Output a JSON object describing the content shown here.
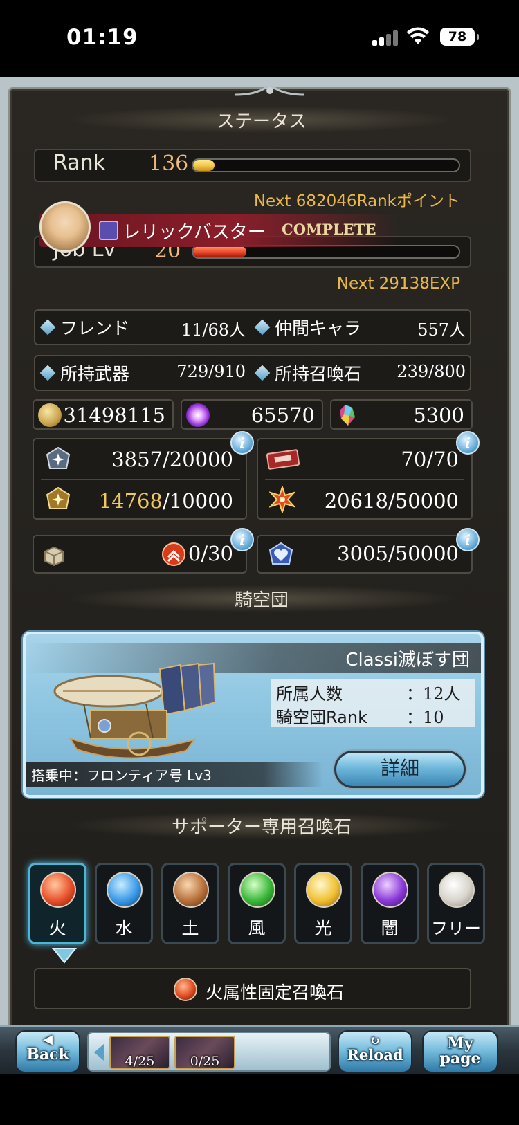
{
  "status_bar": {
    "time": "01:19",
    "battery": "78"
  },
  "status": {
    "title": "ステータス",
    "rank_label": "Rank",
    "rank_value": "136",
    "rank_progress": 0.08,
    "rank_next": "Next 682046Rankポイント",
    "job_name": "レリックバスター",
    "job_complete": "COMPLETE",
    "job_lv_label": "Job Lv",
    "job_lv_value": "20",
    "job_progress": 0.2,
    "job_next": "Next 29138EXP"
  },
  "counts": {
    "friends_label": "フレンド",
    "friends_value": "11/68人",
    "allies_label": "仲間キャラ",
    "allies_value": "557人",
    "weapons_label": "所持武器",
    "weapons_value": "729/910",
    "summons_label": "所持召喚石",
    "summons_value": "239/800"
  },
  "currencies": {
    "rupie": "31498115",
    "crystal_points": "65570",
    "crystals": "5300"
  },
  "items": {
    "item1": "3857/20000",
    "item2_current": "14768",
    "item2_max": "/10000",
    "item3": "70/70",
    "item4": "20618/50000",
    "item5": "0/30",
    "item6": "3005/50000"
  },
  "crew": {
    "section_title": "騎空団",
    "name": "Classi滅ぼす団",
    "members_label": "所属人数",
    "members_value": "：12人",
    "rank_label": "騎空団Rank",
    "rank_value": "：10",
    "boarding": "搭乗中：フロンティア号 Lv3",
    "detail_button": "詳細"
  },
  "supporter": {
    "section_title": "サポーター専用召喚石",
    "tabs": [
      "火",
      "水",
      "土",
      "風",
      "光",
      "闇",
      "フリー"
    ],
    "fixed_label": "火属性固定召喚石"
  },
  "nav": {
    "back": "Back",
    "quest1": "4/25",
    "quest2": "0/25",
    "reload": "Reload",
    "mypage_line1": "My",
    "mypage_line2": "page"
  },
  "colors": {
    "accent_gold": "#e9b84a",
    "rank_fill": "#f2c646",
    "job_fill": "#e8452a",
    "active_tab_glow": "#48b8e0"
  }
}
